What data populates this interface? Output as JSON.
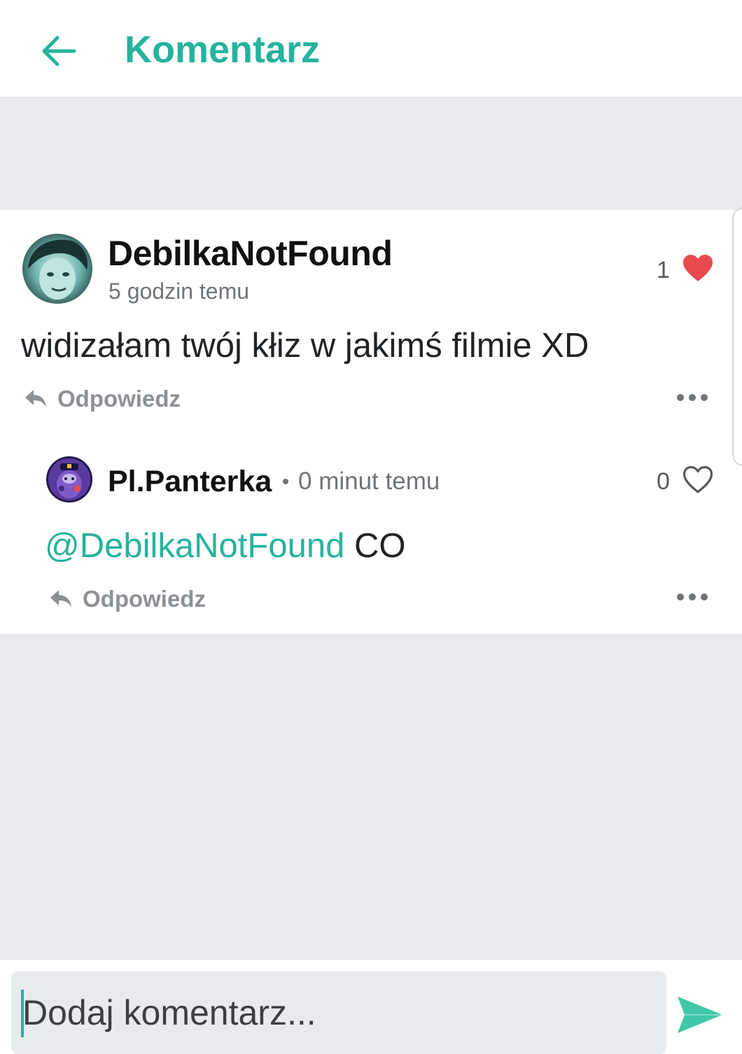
{
  "header": {
    "title": "Komentarz"
  },
  "comment": {
    "author": "DebilkaNotFound",
    "time": "5 godzin temu",
    "text": "widizałam twój kłiz w jakimś filmie XD",
    "likes": "1",
    "liked": true,
    "reply_label": "Odpowiedz"
  },
  "reply": {
    "author": "Pl.Panterka",
    "time": "0 minut temu",
    "mention": "@DebilkaNotFound",
    "text": " CO",
    "likes": "0",
    "liked": false,
    "reply_label": "Odpowiedz"
  },
  "composer": {
    "placeholder": "Dodaj komentarz..."
  },
  "colors": {
    "accent": "#26b39d",
    "heart": "#e84a4f",
    "background": "#e8ebed"
  }
}
